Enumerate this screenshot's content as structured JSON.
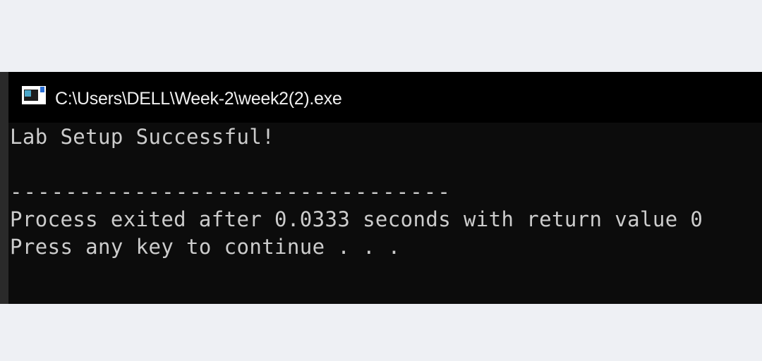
{
  "window": {
    "title": "C:\\Users\\DELL\\Week-2\\week2(2).exe",
    "icon": "console-app-icon"
  },
  "console": {
    "lines": [
      "Lab Setup Successful!",
      "--------------------------------",
      "Process exited after 0.0333 seconds with return value 0",
      "Press any key to continue . . ."
    ]
  },
  "colors": {
    "page_background": "#eef0f4",
    "title_bar": "#000000",
    "console_background": "#0c0c0c",
    "console_text": "#cccccc",
    "title_text": "#f0f0f0"
  }
}
